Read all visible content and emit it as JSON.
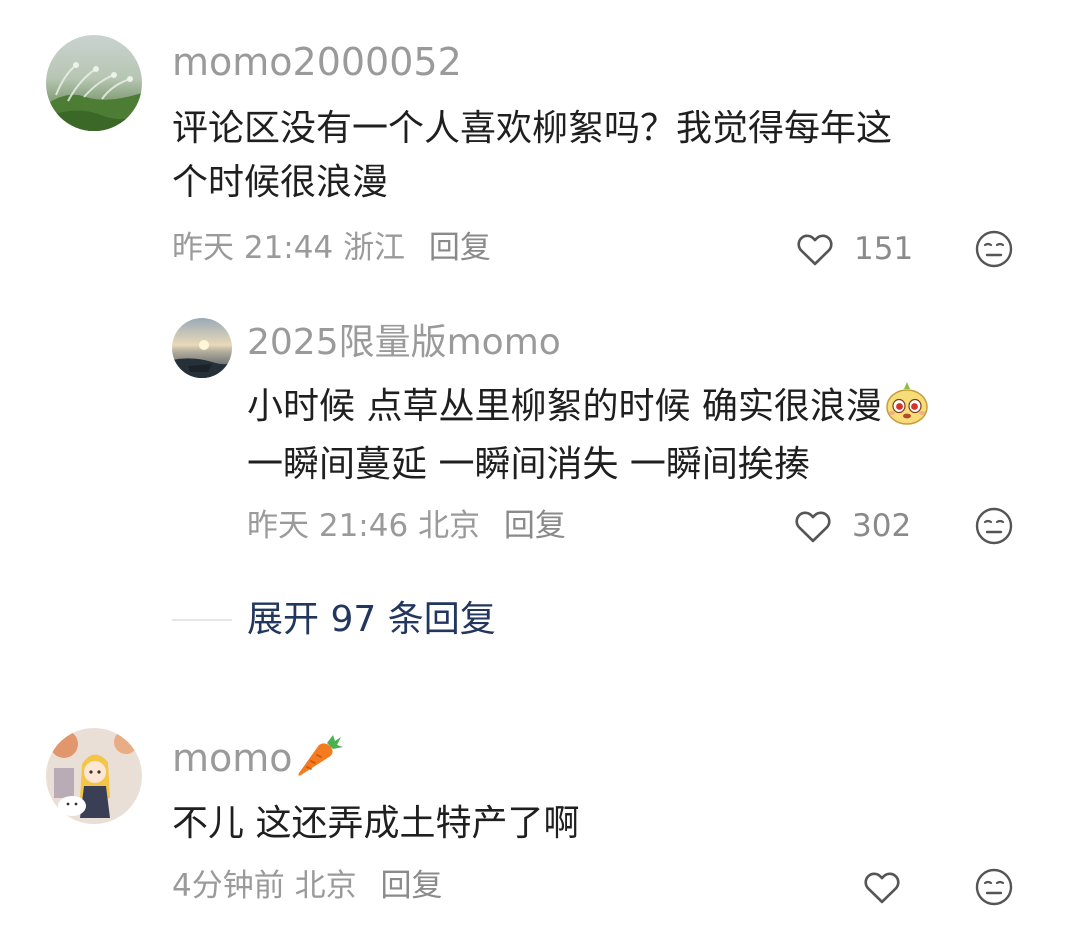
{
  "comments": [
    {
      "username": "momo2000052",
      "content_lines": [
        "评论区没有一个人喜欢柳絮吗？我觉得每年这",
        "个时候很浪漫"
      ],
      "time": "昨天 21:44",
      "location": "浙江",
      "reply_label": "回复",
      "likes": "151",
      "avatar": "grass-photo"
    },
    {
      "username": "momo",
      "username_emoji": "carrot-icon",
      "content_lines": [
        "不儿 这还弄成土特产了啊"
      ],
      "time": "4分钟前",
      "location": "北京",
      "reply_label": "回复",
      "likes": "",
      "avatar": "anime-girl-illustration"
    }
  ],
  "reply": {
    "username": "2025限量版momo",
    "content_lines": [
      "小时候 点草丛里柳絮的时候 确实很浪漫",
      "一瞬间蔓延 一瞬间消失 一瞬间挨揍"
    ],
    "content_emoji": "cute-face-sticker-icon",
    "time": "昨天 21:46",
    "location": "北京",
    "reply_label": "回复",
    "likes": "302",
    "avatar": "sunset-lake-photo"
  },
  "expand_replies": "展开 97 条回复",
  "colors": {
    "text_primary": "#1f1f1f",
    "text_secondary": "#9a9a9a",
    "expand_link": "#22365e",
    "divider": "#e6e6e6"
  }
}
